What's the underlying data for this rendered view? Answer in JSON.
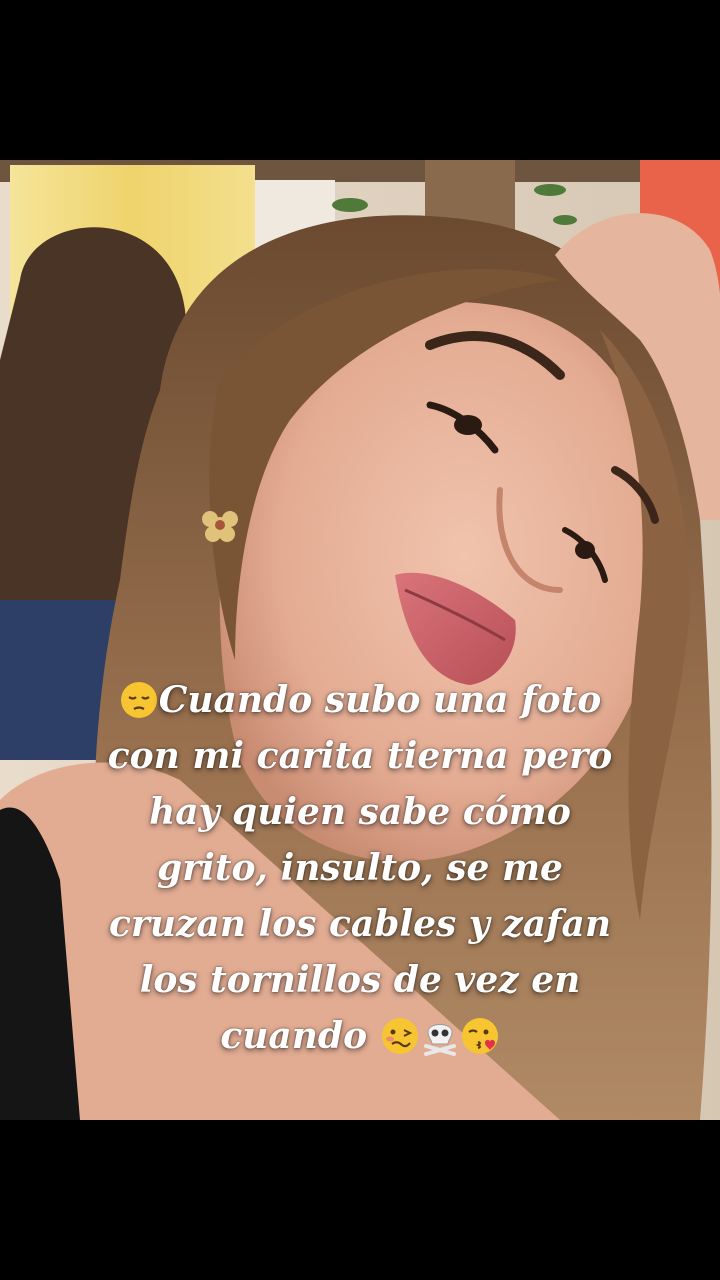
{
  "caption": {
    "lines": [
      "Cuando subo una foto",
      "con mi carita tierna pero",
      "hay quien sabe cómo",
      "grito, insulto, se me",
      "cruzan los cables y zafan",
      "los tornillos de vez en",
      "cuando"
    ],
    "leading_emoji": "pensive-face-emoji",
    "trailing_emojis": [
      "woozy-face-emoji",
      "skull-and-crossbones-emoji",
      "face-blowing-kiss-emoji"
    ]
  },
  "colors": {
    "background": "#000000",
    "caption_text": "#ffffff",
    "curtain": "#f2dc7a",
    "hair": "#7a5535",
    "skin": "#e9b69f"
  }
}
